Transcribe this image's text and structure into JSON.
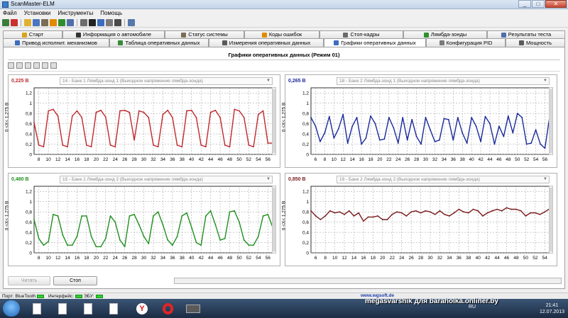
{
  "window": {
    "title": "ScanMaster-ELM",
    "minimize_label": "_",
    "maximize_label": "□",
    "close_label": "✕"
  },
  "menu": [
    "Файл",
    "Установки",
    "Инструменты",
    "Помощь"
  ],
  "tabs_row1": [
    {
      "label": "Старт",
      "icon": "start-icon",
      "color": "#d9a21b"
    },
    {
      "label": "Информация о автомобиле",
      "icon": "info-icon",
      "color": "#333333"
    },
    {
      "label": "Статус системы",
      "icon": "status-icon",
      "color": "#7a6c57"
    },
    {
      "label": "Коды ошибок",
      "icon": "warning-icon",
      "color": "#e28a00"
    },
    {
      "label": "Стоп-кадры",
      "icon": "camera-icon",
      "color": "#6a6a6a"
    },
    {
      "label": "Лямбда-зонды",
      "icon": "sensor-icon",
      "color": "#2f8f2f"
    },
    {
      "label": "Результаты теста",
      "icon": "results-icon",
      "color": "#4f6fa8"
    }
  ],
  "tabs_row2": [
    {
      "label": "Привод исполнит. механизмов",
      "icon": "actuator-icon",
      "color": "#3b6dbf"
    },
    {
      "label": "Таблица оперативных данных",
      "icon": "table-icon",
      "color": "#3a8a3a"
    },
    {
      "label": "Измерения оперативных данных",
      "icon": "gauge-icon",
      "color": "#5a5a5a"
    },
    {
      "label": "Графики оперативных данных",
      "icon": "chart-icon",
      "color": "#3b6dbf",
      "active": true
    },
    {
      "label": "Конфигурация PID",
      "icon": "config-icon",
      "color": "#7a7a7a"
    },
    {
      "label": "Мощность",
      "icon": "power-icon",
      "color": "#5a5a5a"
    }
  ],
  "content": {
    "title": "Графики оперативных данных (Режим 01)",
    "read_button": "Читать",
    "stop_button": "Стоп"
  },
  "statusbar": {
    "port_label": "Порт: BlueTooth",
    "interface_label": "Интерфейс:",
    "ecu_label": "ЭБУ:",
    "link": "www.wgsoft.de"
  },
  "taskbar": {
    "lang": "RU",
    "time": "21:41",
    "date": "12.07.2013"
  },
  "watermark": "megasvarshik для baraholka.onliner.by",
  "chart_data": [
    {
      "type": "line",
      "value_label": "0,225 В",
      "series_selector": "14 - Банк 1 Лямбда-зонд 1 (Выходное напряжение лямбда-зонда)",
      "ylabel": "0 <X< 1,275 В",
      "color": "#c0282d",
      "value_color": "#c0282d",
      "ylim": [
        0,
        1.0
      ],
      "y_ticks": [
        "0",
        "0,2",
        "0,4",
        "0,6",
        "0,8",
        "1",
        "1,2"
      ],
      "y_tick_values": [
        0,
        0.2,
        0.4,
        0.6,
        0.8,
        1.0,
        1.2
      ],
      "xlim": [
        7,
        57
      ],
      "x_ticks": [
        8,
        10,
        12,
        14,
        16,
        18,
        20,
        22,
        24,
        26,
        28,
        30,
        32,
        34,
        36,
        38,
        40,
        42,
        44,
        46,
        48,
        50,
        52,
        54,
        56
      ],
      "x": [
        7,
        8,
        9,
        10,
        11,
        12,
        13,
        14,
        15,
        16,
        17,
        18,
        19,
        20,
        21,
        22,
        23,
        24,
        25,
        26,
        27,
        28,
        29,
        30,
        31,
        32,
        33,
        34,
        35,
        36,
        37,
        38,
        39,
        40,
        41,
        42,
        43,
        44,
        45,
        46,
        47,
        48,
        49,
        50,
        51,
        52,
        53,
        54,
        55,
        56,
        57
      ],
      "y": [
        0.62,
        0.18,
        0.15,
        0.85,
        0.88,
        0.75,
        0.18,
        0.15,
        0.75,
        0.85,
        0.72,
        0.18,
        0.15,
        0.82,
        0.86,
        0.73,
        0.18,
        0.15,
        0.85,
        0.86,
        0.82,
        0.28,
        0.85,
        0.82,
        0.72,
        0.18,
        0.15,
        0.78,
        0.86,
        0.72,
        0.18,
        0.15,
        0.85,
        0.86,
        0.72,
        0.18,
        0.15,
        0.82,
        0.86,
        0.72,
        0.18,
        0.15,
        0.88,
        0.85,
        0.72,
        0.18,
        0.15,
        0.78,
        0.85,
        0.22,
        0.22
      ]
    },
    {
      "type": "line",
      "value_label": "0,265 В",
      "series_selector": "18 - Банк 2 Лямбда-зонд 1 (Выходное напряжение лямбда-зонда)",
      "ylabel": "0 <X< 1,275 В",
      "color": "#1a2a9c",
      "value_color": "#1a2a9c",
      "ylim": [
        0,
        1.0
      ],
      "y_ticks": [
        "0",
        "0,2",
        "0,4",
        "0,6",
        "0,8",
        "1",
        "1,2"
      ],
      "y_tick_values": [
        0,
        0.2,
        0.4,
        0.6,
        0.8,
        1.0,
        1.2
      ],
      "xlim": [
        5,
        57
      ],
      "x_ticks": [
        6,
        8,
        10,
        12,
        14,
        16,
        18,
        20,
        22,
        24,
        26,
        28,
        30,
        32,
        34,
        36,
        38,
        40,
        42,
        44,
        46,
        48,
        50,
        52,
        54,
        56
      ],
      "x": [
        5,
        6,
        7,
        8,
        9,
        10,
        11,
        12,
        13,
        14,
        15,
        16,
        17,
        18,
        19,
        20,
        21,
        22,
        23,
        24,
        25,
        26,
        27,
        28,
        29,
        30,
        31,
        32,
        33,
        34,
        35,
        36,
        37,
        38,
        39,
        40,
        41,
        42,
        43,
        44,
        45,
        46,
        47,
        48,
        49,
        50,
        51,
        52,
        53,
        54,
        55,
        56,
        57
      ],
      "y": [
        0.72,
        0.55,
        0.25,
        0.42,
        0.74,
        0.32,
        0.5,
        0.78,
        0.22,
        0.55,
        0.72,
        0.2,
        0.32,
        0.75,
        0.6,
        0.28,
        0.3,
        0.72,
        0.52,
        0.22,
        0.72,
        0.28,
        0.68,
        0.35,
        0.2,
        0.72,
        0.48,
        0.25,
        0.28,
        0.7,
        0.68,
        0.28,
        0.72,
        0.42,
        0.22,
        0.72,
        0.55,
        0.25,
        0.74,
        0.6,
        0.2,
        0.55,
        0.35,
        0.75,
        0.42,
        0.8,
        0.72,
        0.2,
        0.22,
        0.48,
        0.2,
        0.12,
        0.72
      ]
    },
    {
      "type": "line",
      "value_label": "0,480 В",
      "series_selector": "15 - Банк 1 Лямбда-зонд 2 (Выходное напряжение лямбда-зонда)",
      "ylabel": "0 <X< 1,275 В",
      "color": "#1f8f1f",
      "value_color": "#1f8f1f",
      "ylim": [
        0,
        1.0
      ],
      "y_ticks": [
        "0",
        "0,2",
        "0,4",
        "0,6",
        "0,8",
        "1",
        "1,2"
      ],
      "y_tick_values": [
        0,
        0.2,
        0.4,
        0.6,
        0.8,
        1.0,
        1.2
      ],
      "xlim": [
        7,
        57
      ],
      "x_ticks": [
        8,
        10,
        12,
        14,
        16,
        18,
        20,
        22,
        24,
        26,
        28,
        30,
        32,
        34,
        36,
        38,
        40,
        42,
        44,
        46,
        48,
        50,
        52,
        54,
        56
      ],
      "x": [
        7,
        8,
        9,
        10,
        11,
        12,
        13,
        14,
        15,
        16,
        17,
        18,
        19,
        20,
        21,
        22,
        23,
        24,
        25,
        26,
        27,
        28,
        29,
        30,
        31,
        32,
        33,
        34,
        35,
        36,
        37,
        38,
        39,
        40,
        41,
        42,
        43,
        44,
        45,
        46,
        47,
        48,
        49,
        50,
        51,
        52,
        53,
        54,
        55,
        56,
        57
      ],
      "y": [
        0.65,
        0.28,
        0.15,
        0.22,
        0.75,
        0.72,
        0.35,
        0.15,
        0.15,
        0.32,
        0.72,
        0.72,
        0.32,
        0.12,
        0.12,
        0.28,
        0.72,
        0.6,
        0.25,
        0.12,
        0.72,
        0.75,
        0.55,
        0.32,
        0.18,
        0.72,
        0.8,
        0.55,
        0.25,
        0.15,
        0.32,
        0.72,
        0.78,
        0.5,
        0.2,
        0.15,
        0.72,
        0.82,
        0.55,
        0.25,
        0.28,
        0.8,
        0.82,
        0.6,
        0.25,
        0.15,
        0.15,
        0.32,
        0.72,
        0.75,
        0.5
      ]
    },
    {
      "type": "line",
      "value_label": "0,850 В",
      "series_selector": "19 - Банк 2 Лямбда-зонд 2 (Выходное напряжение лямбда-зонда)",
      "ylabel": "0 <X< 1,275 В",
      "color": "#7a1a1a",
      "value_color": "#7a1a1a",
      "ylim": [
        0,
        1.0
      ],
      "y_ticks": [
        "0",
        "0,2",
        "0,4",
        "0,6",
        "0,8",
        "1",
        "1,2"
      ],
      "y_tick_values": [
        0,
        0.2,
        0.4,
        0.6,
        0.8,
        1.0,
        1.2
      ],
      "xlim": [
        5,
        55
      ],
      "x_ticks": [
        6,
        8,
        10,
        12,
        14,
        16,
        18,
        20,
        22,
        24,
        26,
        28,
        30,
        32,
        34,
        36,
        38,
        40,
        42,
        44,
        46,
        48,
        50,
        52,
        54
      ],
      "x": [
        5,
        6,
        7,
        8,
        9,
        10,
        11,
        12,
        13,
        14,
        15,
        16,
        17,
        18,
        19,
        20,
        21,
        22,
        23,
        24,
        25,
        26,
        27,
        28,
        29,
        30,
        31,
        32,
        33,
        34,
        35,
        36,
        37,
        38,
        39,
        40,
        41,
        42,
        43,
        44,
        45,
        46,
        47,
        48,
        49,
        50,
        51,
        52,
        53,
        54,
        55
      ],
      "y": [
        0.82,
        0.72,
        0.65,
        0.72,
        0.82,
        0.78,
        0.8,
        0.75,
        0.82,
        0.72,
        0.78,
        0.62,
        0.7,
        0.7,
        0.72,
        0.65,
        0.65,
        0.75,
        0.8,
        0.78,
        0.72,
        0.8,
        0.82,
        0.78,
        0.82,
        0.8,
        0.75,
        0.82,
        0.75,
        0.72,
        0.78,
        0.85,
        0.8,
        0.78,
        0.85,
        0.82,
        0.72,
        0.78,
        0.82,
        0.85,
        0.82,
        0.88,
        0.85,
        0.85,
        0.82,
        0.72,
        0.78,
        0.78,
        0.75,
        0.8,
        0.86
      ]
    }
  ]
}
